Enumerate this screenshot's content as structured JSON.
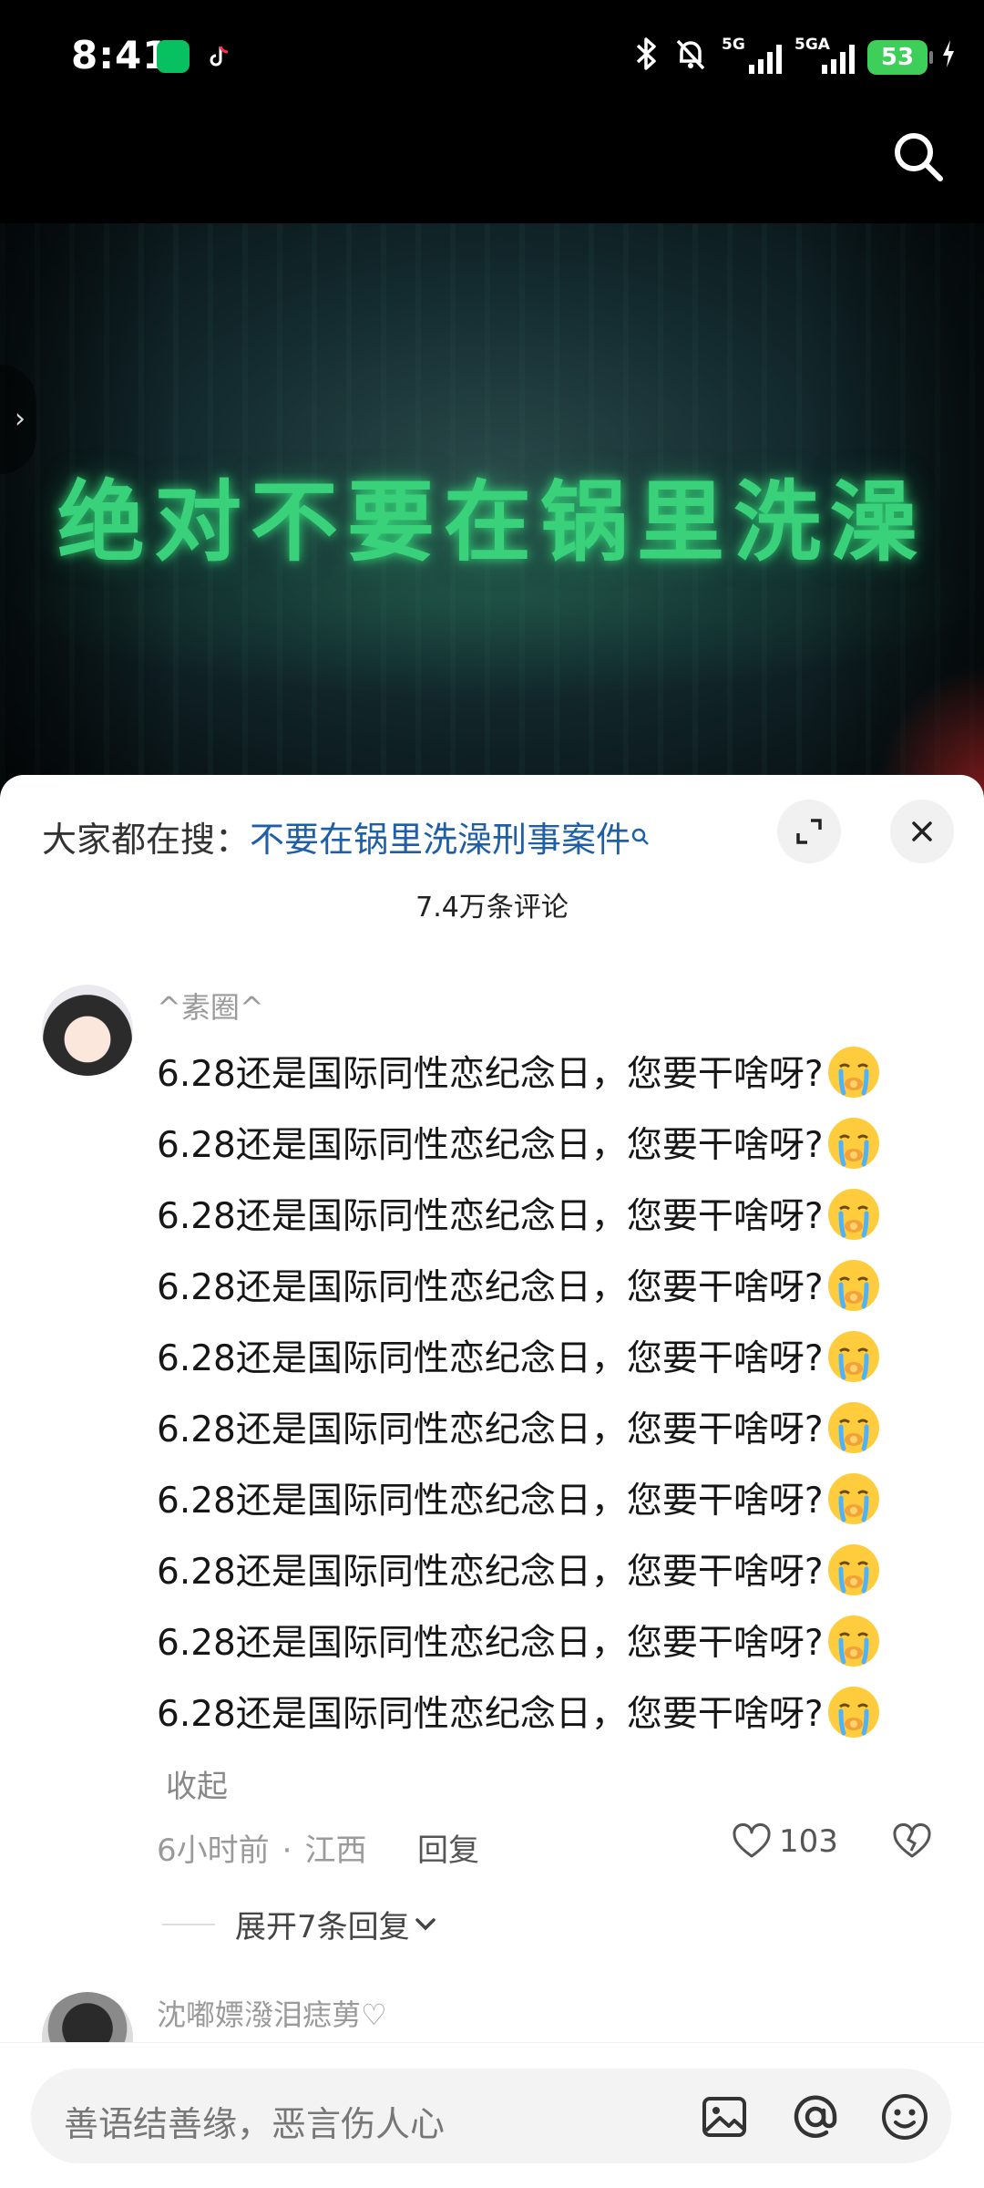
{
  "status_bar": {
    "time": "8:41",
    "network_1": "5G",
    "network_2": "5GA",
    "battery": "53",
    "icons": [
      "wechat-icon",
      "tiktok-icon",
      "bluetooth-icon",
      "mute-icon",
      "charging-icon"
    ]
  },
  "video": {
    "overlay_title": "绝对不要在锅里洗澡"
  },
  "search_bar": {
    "prefix": "大家都在搜：",
    "query": "不要在锅里洗澡刑事案件"
  },
  "comments_panel": {
    "count_label": "7.4万条评论",
    "comments": [
      {
        "username": "^素圈^",
        "text_segments": [
          "6.28还是国际同性恋纪念日，您要干啥呀?",
          "6.28还是国际同性恋纪念日，您要干啥呀?",
          "6.28还是国际同性恋纪念日，您要干啥呀?",
          "6.28还是国际同性恋纪念日，您要干啥呀?",
          "6.28还是国际同性恋纪念日，您要干啥呀?",
          "6.28还是国际同性恋纪念日，您要干啥呀?",
          "6.28还是国际同性恋纪念日，您要干啥呀?",
          "6.28还是国际同性恋纪念日，您要干啥呀?",
          "6.28还是国际同性恋纪念日，您要干啥呀?",
          "6.28还是国际同性恋纪念日，您要干啥呀?"
        ],
        "collapse_label": "收起",
        "time": "6小时前",
        "location": "江西",
        "reply_label": "回复",
        "likes": "103",
        "expand_replies": "展开7条回复"
      },
      {
        "username": "沈嘟嫖潑泪痣莮♡"
      }
    ]
  },
  "input": {
    "placeholder": "善语结善缘，恶言伤人心"
  },
  "colors": {
    "link": "#1f5fa8",
    "video_text": "#39d27a",
    "battery": "#3ecf5b"
  }
}
